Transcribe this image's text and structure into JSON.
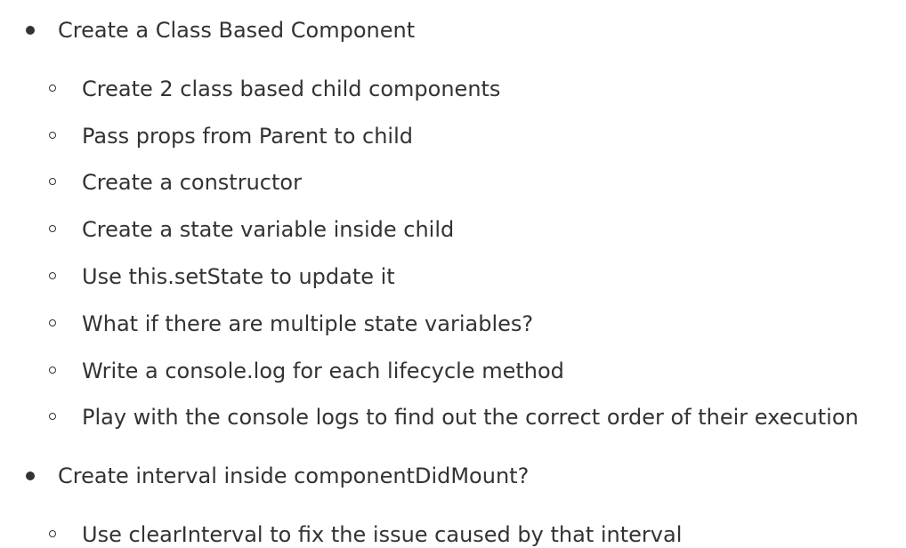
{
  "items": [
    {
      "label": "Create a Class Based Component",
      "children": [
        "Create 2 class based child components",
        "Pass props from Parent to child",
        "Create a constructor",
        "Create a state variable inside child",
        "Use this.setState to update it",
        "What if there are multiple state variables?",
        "Write a console.log for each lifecycle method",
        "Play with the console logs to find out the correct order of their execution"
      ]
    },
    {
      "label": "Create interval inside componentDidMount?",
      "children": [
        "Use clearInterval to fix the issue caused by that interval"
      ]
    }
  ]
}
